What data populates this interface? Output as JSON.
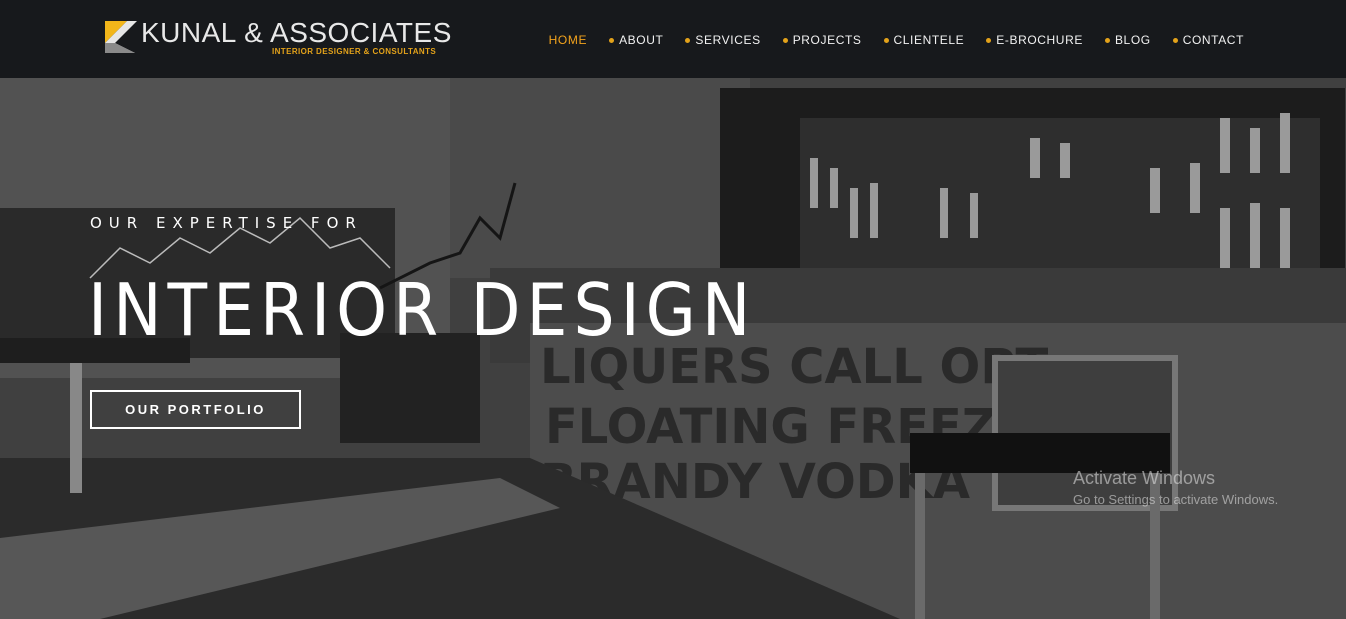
{
  "header": {
    "logo_title": "KUNAL & ASSOCIATES",
    "logo_tagline": "INTERIOR DESIGNER & CONSULTANTS",
    "nav": [
      {
        "label": "HOME",
        "active": true
      },
      {
        "label": "ABOUT"
      },
      {
        "label": "SERVICES"
      },
      {
        "label": "PROJECTS"
      },
      {
        "label": "CLIENTELE"
      },
      {
        "label": "E-BROCHURE"
      },
      {
        "label": "BLOG"
      },
      {
        "label": "CONTACT"
      }
    ]
  },
  "hero": {
    "subtitle": "OUR EXPERTISE FOR",
    "title": "INTERIOR DESIGN",
    "button_label": "OUR PORTFOLIO"
  },
  "watermark": {
    "title": "Activate Windows",
    "subtitle": "Go to Settings to activate Windows."
  },
  "colors": {
    "accent": "#f3a31c",
    "header_bg": "#17191c"
  }
}
